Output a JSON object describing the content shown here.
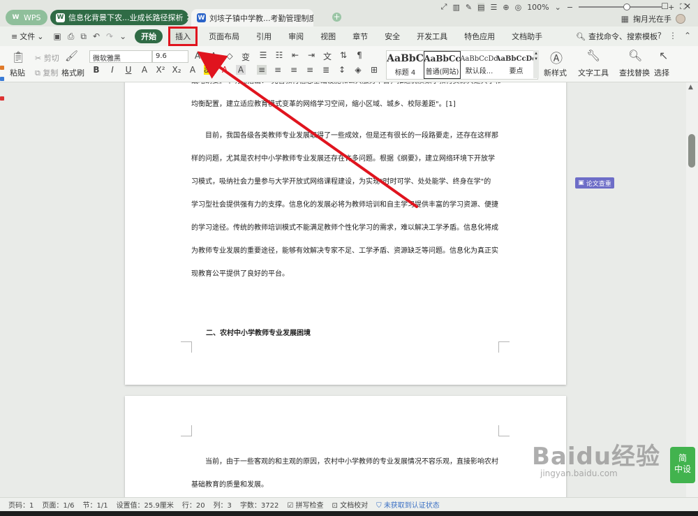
{
  "tabs": [
    {
      "label": "WPS",
      "icon": "wps-logo-icon"
    },
    {
      "label": "信息化背景下农...业成长路径探析",
      "icon": "document-icon"
    },
    {
      "label": "刘垓子镇中学教...考勤管理制度2",
      "icon": "document-icon"
    }
  ],
  "account": {
    "name": "掬月光在手"
  },
  "menu": {
    "file": "文件",
    "start": "开始",
    "insert": "插入",
    "tabs": [
      "页面布局",
      "引用",
      "审阅",
      "视图",
      "章节",
      "安全",
      "开发工具",
      "特色应用",
      "文档助手"
    ],
    "search": "查找命令、搜索模板"
  },
  "ribbon": {
    "paste": "粘贴",
    "cut": "剪切",
    "copy": "复制",
    "format_painter": "格式刷",
    "font_name": "微软雅黑",
    "font_size": "9.6",
    "styles": [
      {
        "sample": "AaBbC",
        "name": "标题 4"
      },
      {
        "sample": "AaBbCc",
        "name": "普通(网站)"
      },
      {
        "sample": "AaBbCcDd",
        "name": "默认段..."
      },
      {
        "sample": "AaBbCcDd",
        "name": "要点"
      }
    ],
    "new_style": "新样式",
    "text_tools": "文字工具",
    "find_replace": "查找替换",
    "select": "选择"
  },
  "document": {
    "page1_para1": [
      "战略纲要》中明确指出：\"完善教育信息基础设施和公共服务平台，推进优质数字教育资源共建共享和",
      "均衡配置，建立适应教育模式变革的网络学习空间，缩小区域、城乡、校际差距\"。[1]"
    ],
    "page1_para2": [
      "目前，我国各级各类教师专业发展取得了一些成效，但是还有很长的一段路要走，还存在这样那",
      "样的问题，尤其是农村中小学教师专业发展还存在许多问题。根据《纲要》，建立网络环境下开放学",
      "习模式，吸纳社会力量参与大学开放式网络课程建设，为实现\"时时可学、处处能学、终身在学\"的",
      "学习型社会提供强有力的支撑。信息化的发展必将为教师培训和自主学习提供丰富的学习资源、便捷",
      "的学习途径。传统的教师培训模式不能满足教师个性化学习的需求，难以解决工学矛盾。信息化将成",
      "为教师专业发展的重要途径，能够有效解决专家不足、工学矛盾、资源缺乏等问题。信息化为真正实",
      "现教育公平提供了良好的平台。"
    ],
    "heading": "二、农村中小学教师专业发展困境",
    "page2_para": [
      "当前，由于一些客观的和主观的原因，农村中小学教师的专业发展情况不容乐观，直接影响农村",
      "基础教育的质量和发展。"
    ]
  },
  "side": {
    "paper_check": "论文查重",
    "baidu_tile": [
      "简",
      "中设"
    ]
  },
  "watermark": {
    "brand": "Baidu经验",
    "url": "jingyan.baidu.com"
  },
  "status": {
    "page_code": "页码：1",
    "page": "页面：1/6",
    "section": "节：1/1",
    "setting": "设置值：25.9厘米",
    "row": "行：20",
    "col": "列：3",
    "word_count": "字数：3722",
    "spell_check": "拼写检查",
    "doc_proof": "文档校对",
    "cert": "未获取到认证状态",
    "zoom": "100%",
    "zoom_fraction": 0.58
  },
  "colors": {
    "accent": "#2f6b45",
    "highlight": "#e0141e",
    "arrow": "#e0141e"
  }
}
